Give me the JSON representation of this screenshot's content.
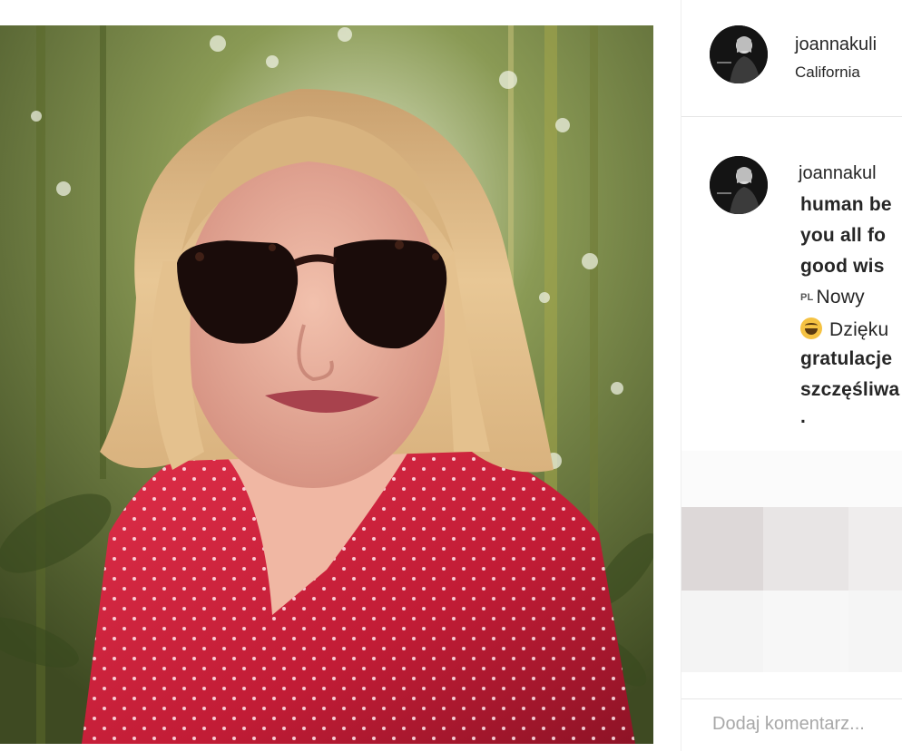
{
  "post": {
    "image_alt": "Selfie of a woman with blonde bob hair wearing dark sunglasses and a red polka-dot top outdoors among bamboo",
    "username": "joannakuli",
    "location": "California"
  },
  "caption": {
    "username": "joannakul",
    "lines": [
      "human be",
      "you all fo",
      "good wis"
    ],
    "flag_label": "PL",
    "pl_line": "Nowy",
    "emoji_name": "grinning-face-emoji",
    "emoji_line": "Dzięku",
    "lines_pl": [
      "gratulacje",
      "szczęśliwa",
      "."
    ]
  },
  "comment": {
    "placeholder": "Dodaj komentarz..."
  },
  "colors": {
    "text": "#262626",
    "border": "#e6e6e6",
    "placeholder": "#a8a8a8"
  }
}
